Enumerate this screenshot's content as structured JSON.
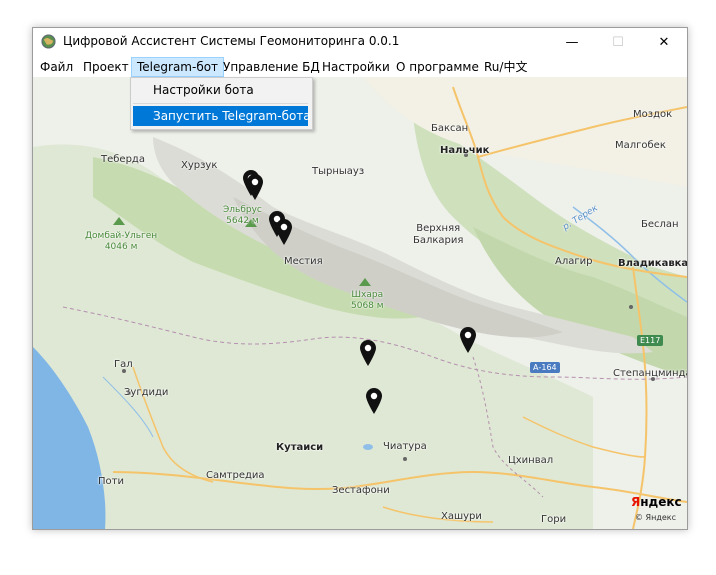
{
  "window": {
    "title": "Цифровой Ассистент Системы Геомониторинга 0.0.1",
    "controls": {
      "minimize": "—",
      "maximize": "☐",
      "close": "✕"
    }
  },
  "menu": {
    "file": "Файл",
    "project": "Проект",
    "telegram": "Telegram-бот",
    "db": "Управление БД",
    "settings": "Настройки",
    "about": "О программе",
    "lang": "Ru/中文"
  },
  "dropdown": {
    "bot_settings": "Настройки бота",
    "start_bot": "Запустить Telegram-бота"
  },
  "map": {
    "labels": {
      "baksan": "Баксан",
      "mozdok": "Моздок",
      "nalchik": "Нальчик",
      "malgobek": "Малгобек",
      "teberda": "Теберда",
      "khurzuk": "Хурзук",
      "tyrnyauz": "Тырныауз",
      "verkhnyaya_balkaria": "Верхняя\nБалкария",
      "beslan": "Беслан",
      "alagir": "Алагир",
      "vladikavkaz": "Владикавказ",
      "mestia": "Местия",
      "gal": "Гал",
      "zugdidi": "Зугдиди",
      "stepantsminda": "Степанцминда",
      "kutaisi": "Кутаиси",
      "chiatura": "Чиатура",
      "tskhinval": "Цхинвал",
      "poti": "Поти",
      "samtredia": "Самтредиа",
      "zestafoni": "Зестафони",
      "khashuri": "Хашури",
      "gori": "Гори"
    },
    "peaks": {
      "elbrus": "Эльбрус\n5642 м",
      "dombai": "Домбай-Ульген\n4046 м",
      "shkhara": "Шхара\n5068 м"
    },
    "river": "р. Терек",
    "roads": {
      "e117": "E117",
      "a164": "А-164"
    },
    "attribution": {
      "brand_y": "Я",
      "brand_rest": "ндекс",
      "copyright": "© Яндекс"
    },
    "colors": {
      "sea": "#7fb6e6",
      "forest": "#c6dcb0",
      "mountain": "#dcdcd6",
      "road": "#f5c46a"
    }
  }
}
